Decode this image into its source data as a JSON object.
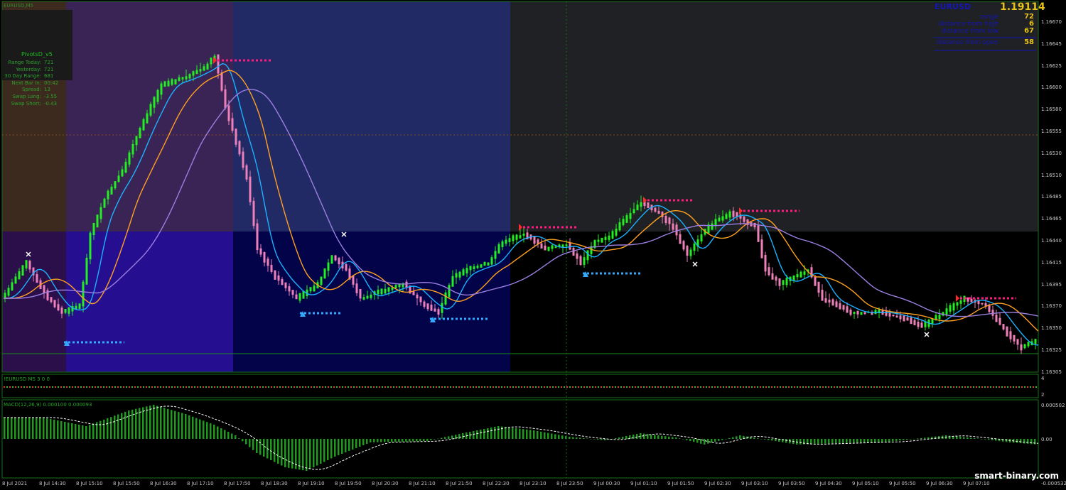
{
  "window": {
    "symbol_title": "EURUSD,M5"
  },
  "info_panel": {
    "symbol": "EURUSD",
    "price": "1.19114",
    "rows": [
      {
        "label": "range",
        "value": "72"
      },
      {
        "label": "distance from high",
        "value": "6"
      },
      {
        "label": "distance from low",
        "value": "67"
      },
      {
        "label": "distance from open",
        "value": "58"
      }
    ]
  },
  "pivots_panel": {
    "title": "PivotsD_v5",
    "rows": [
      {
        "label": "Range Today:",
        "value": "721"
      },
      {
        "label": "Yesterday:",
        "value": "721"
      },
      {
        "label": "30 Day Range:",
        "value": "681"
      },
      {
        "label": "Next Bar In:",
        "value": "00:42"
      },
      {
        "label": "Spread:",
        "value": "13"
      },
      {
        "label": "Swap Long:",
        "value": "-3.55"
      },
      {
        "label": "Swap Short:",
        "value": "-0.43"
      }
    ]
  },
  "indicators": {
    "ms_title": "!EURUSD MS 3 0 0",
    "ms_scale": [
      "4",
      "2"
    ],
    "macd_title": "MACD(12,26,9) 0.000100 0.000093",
    "macd_scale": [
      "0.000502",
      "0.00",
      "-0.000532"
    ]
  },
  "price_axis": [
    "1.16670",
    "1.16645",
    "1.16625",
    "1.16600",
    "1.16580",
    "1.16555",
    "1.16530",
    "1.16510",
    "1.16485",
    "1.16465",
    "1.16440",
    "1.16415",
    "1.16395",
    "1.16370",
    "1.16350",
    "1.16325",
    "1.16305"
  ],
  "time_axis": [
    "8 Jul 2021",
    "8 Jul 14:30",
    "8 Jul 15:10",
    "8 Jul 15:50",
    "8 Jul 16:30",
    "8 Jul 17:10",
    "8 Jul 17:50",
    "8 Jul 18:30",
    "8 Jul 19:10",
    "8 Jul 19:50",
    "8 Jul 20:30",
    "8 Jul 21:10",
    "8 Jul 21:50",
    "8 Jul 22:30",
    "8 Jul 23:10",
    "8 Jul 23:50",
    "9 Jul 00:30",
    "9 Jul 01:10",
    "9 Jul 01:50",
    "9 Jul 02:30",
    "9 Jul 03:10",
    "9 Jul 03:50",
    "9 Jul 04:30",
    "9 Jul 05:10",
    "9 Jul 05:50",
    "9 Jul 06:30",
    "9 Jul 07:10"
  ],
  "watermark": "smart-binary.com",
  "colors": {
    "bull_candle": "#22ee22",
    "bear_candle": "#ee7fb8",
    "ma_fast": "#1ab2ff",
    "ma_mid": "#ffa020",
    "ma_slow": "#9b7fe0",
    "resistance": "#ff1a80",
    "support": "#33aaff"
  }
}
